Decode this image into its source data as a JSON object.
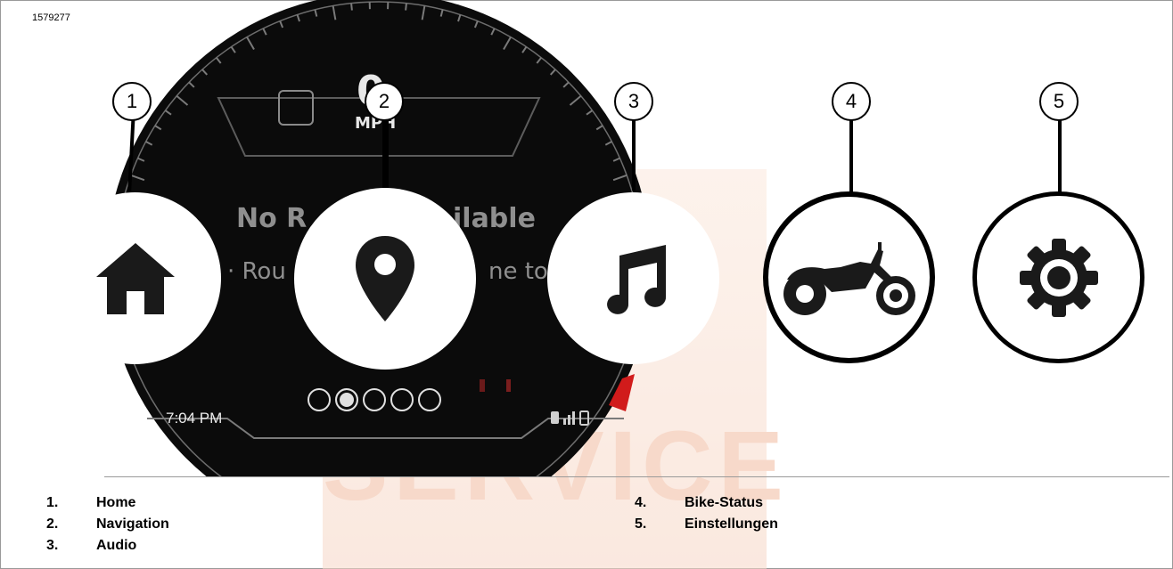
{
  "figure_id": "1579277",
  "dashboard": {
    "speed": "0",
    "speed_unit": "MPH",
    "route_title_left": "No R",
    "route_title_right": "ilable",
    "route_sub_left": "· Rou",
    "route_sub_right": "ne to",
    "clock": "7:04 PM",
    "page_dots": 5,
    "active_dot": 2
  },
  "callouts": [
    "1",
    "2",
    "3",
    "4",
    "5"
  ],
  "icons": [
    "home-icon",
    "location-pin-icon",
    "music-note-icon",
    "motorcycle-icon",
    "gear-icon"
  ],
  "legend": [
    {
      "num": "1.",
      "label": "Home"
    },
    {
      "num": "2.",
      "label": "Navigation"
    },
    {
      "num": "3.",
      "label": "Audio"
    },
    {
      "num": "4.",
      "label": "Bike-Status"
    },
    {
      "num": "5.",
      "label": "Einstellungen"
    }
  ],
  "watermark": "SERVICE",
  "colors": {
    "dashboard_bg": "#0b0b0b",
    "accent_red": "#d11b1b",
    "icon": "#1a1a1a"
  }
}
